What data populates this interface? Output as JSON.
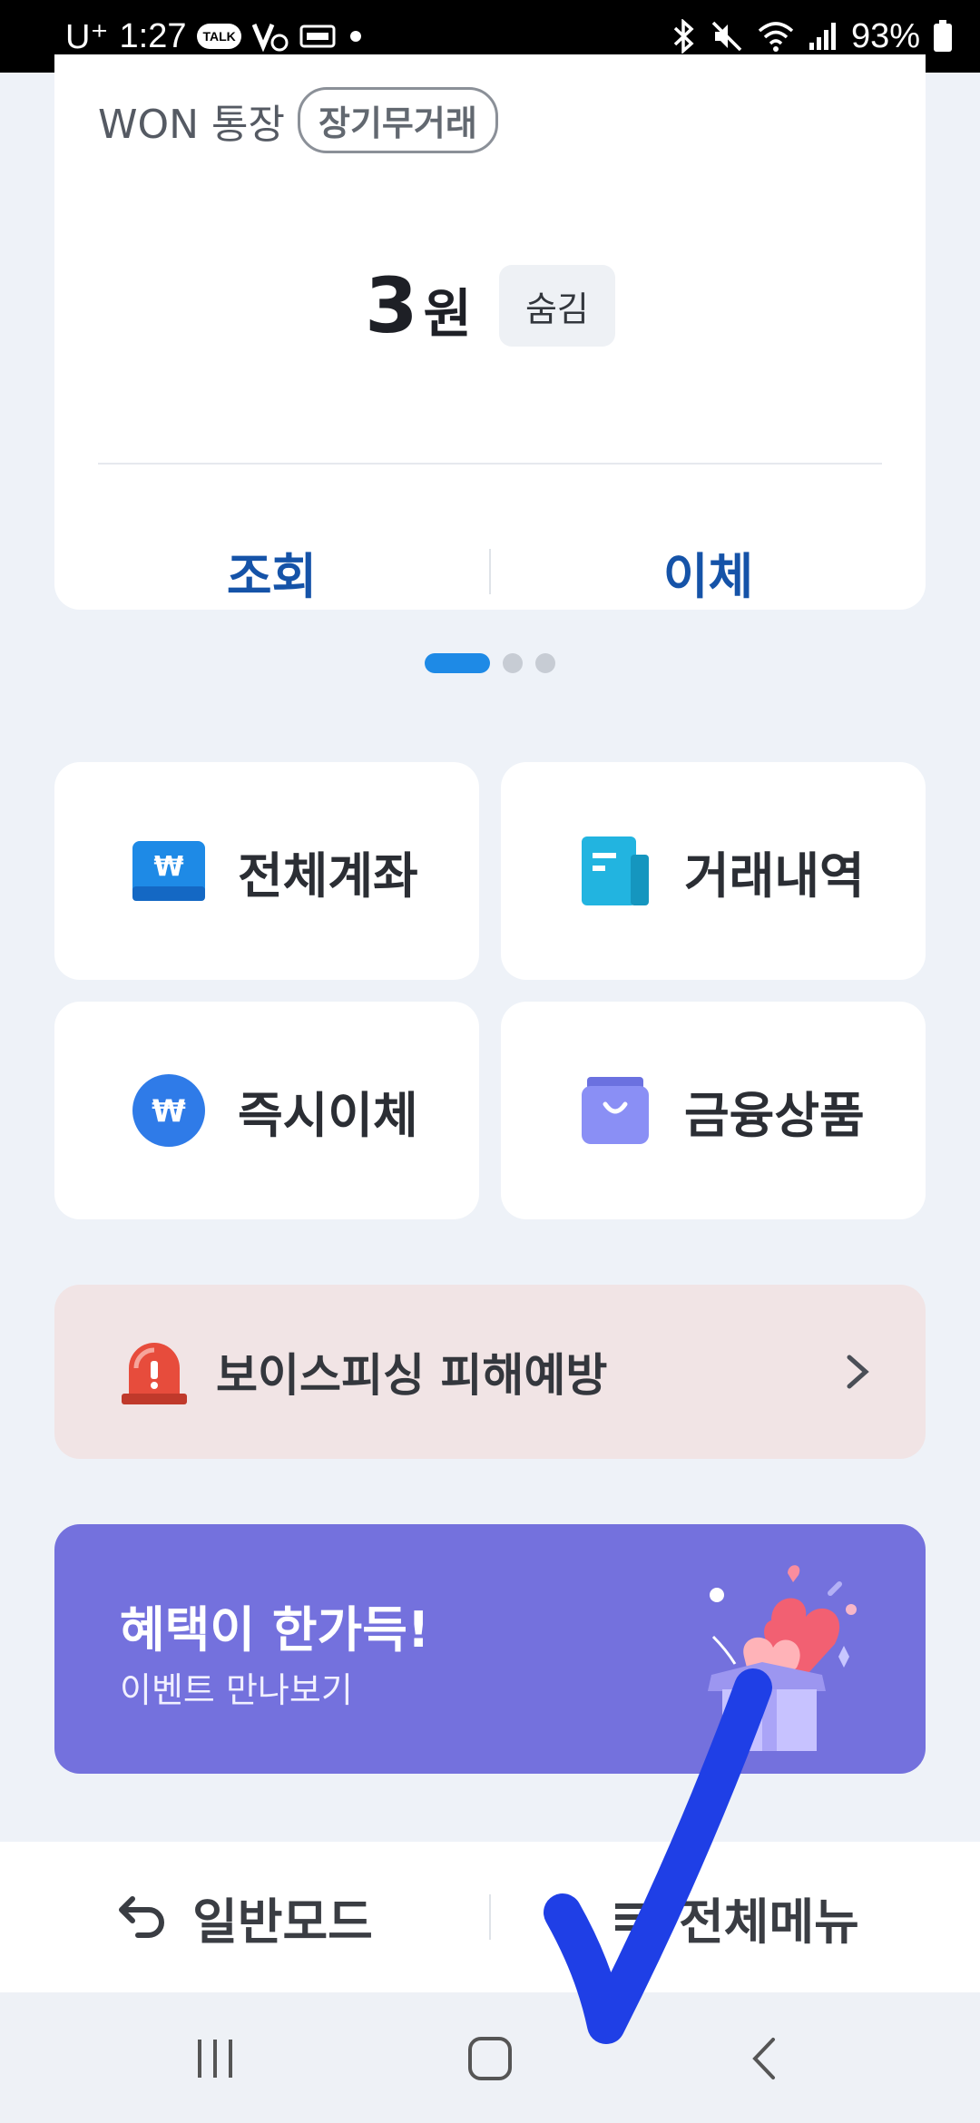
{
  "status_bar": {
    "carrier": "U⁺",
    "time": "1:27",
    "battery": "93%",
    "notification_icons": [
      "kakaotalk-icon",
      "v3-icon",
      "card-icon",
      "dot-icon"
    ],
    "system_icons": [
      "bluetooth-icon",
      "mute-icon",
      "wifi-icon",
      "signal-icon",
      "battery-icon"
    ]
  },
  "account_card": {
    "account_name": "WON 통장",
    "badge": "장기무거래",
    "amount": "3",
    "currency_unit": "원",
    "hide_label": "숨김",
    "actions": [
      "조회",
      "이체"
    ]
  },
  "pagination": {
    "total": 3,
    "active": 0
  },
  "tiles": [
    {
      "label": "전체계좌",
      "icon": "won-card-icon"
    },
    {
      "label": "거래내역",
      "icon": "receipt-icon"
    },
    {
      "label": "즉시이체",
      "icon": "won-circle-icon"
    },
    {
      "label": "금융상품",
      "icon": "shopping-bag-icon"
    }
  ],
  "phishing_banner": {
    "label": "보이스피싱 피해예방",
    "icon": "siren-icon"
  },
  "event_banner": {
    "title": "혜택이 한가득!",
    "subtitle": "이벤트 만나보기",
    "illustration": "gift-box-hearts-icon"
  },
  "bottom_bar": {
    "left_label": "일반모드",
    "right_label": "전체메뉴"
  },
  "nav_bar": {
    "buttons": [
      "recent-apps",
      "home",
      "back"
    ]
  },
  "colors": {
    "accent_blue": "#1553a8",
    "event_purple": "#7471dd",
    "phishing_bg": "#f1e4e5",
    "check_mark": "#1f3fe6"
  }
}
